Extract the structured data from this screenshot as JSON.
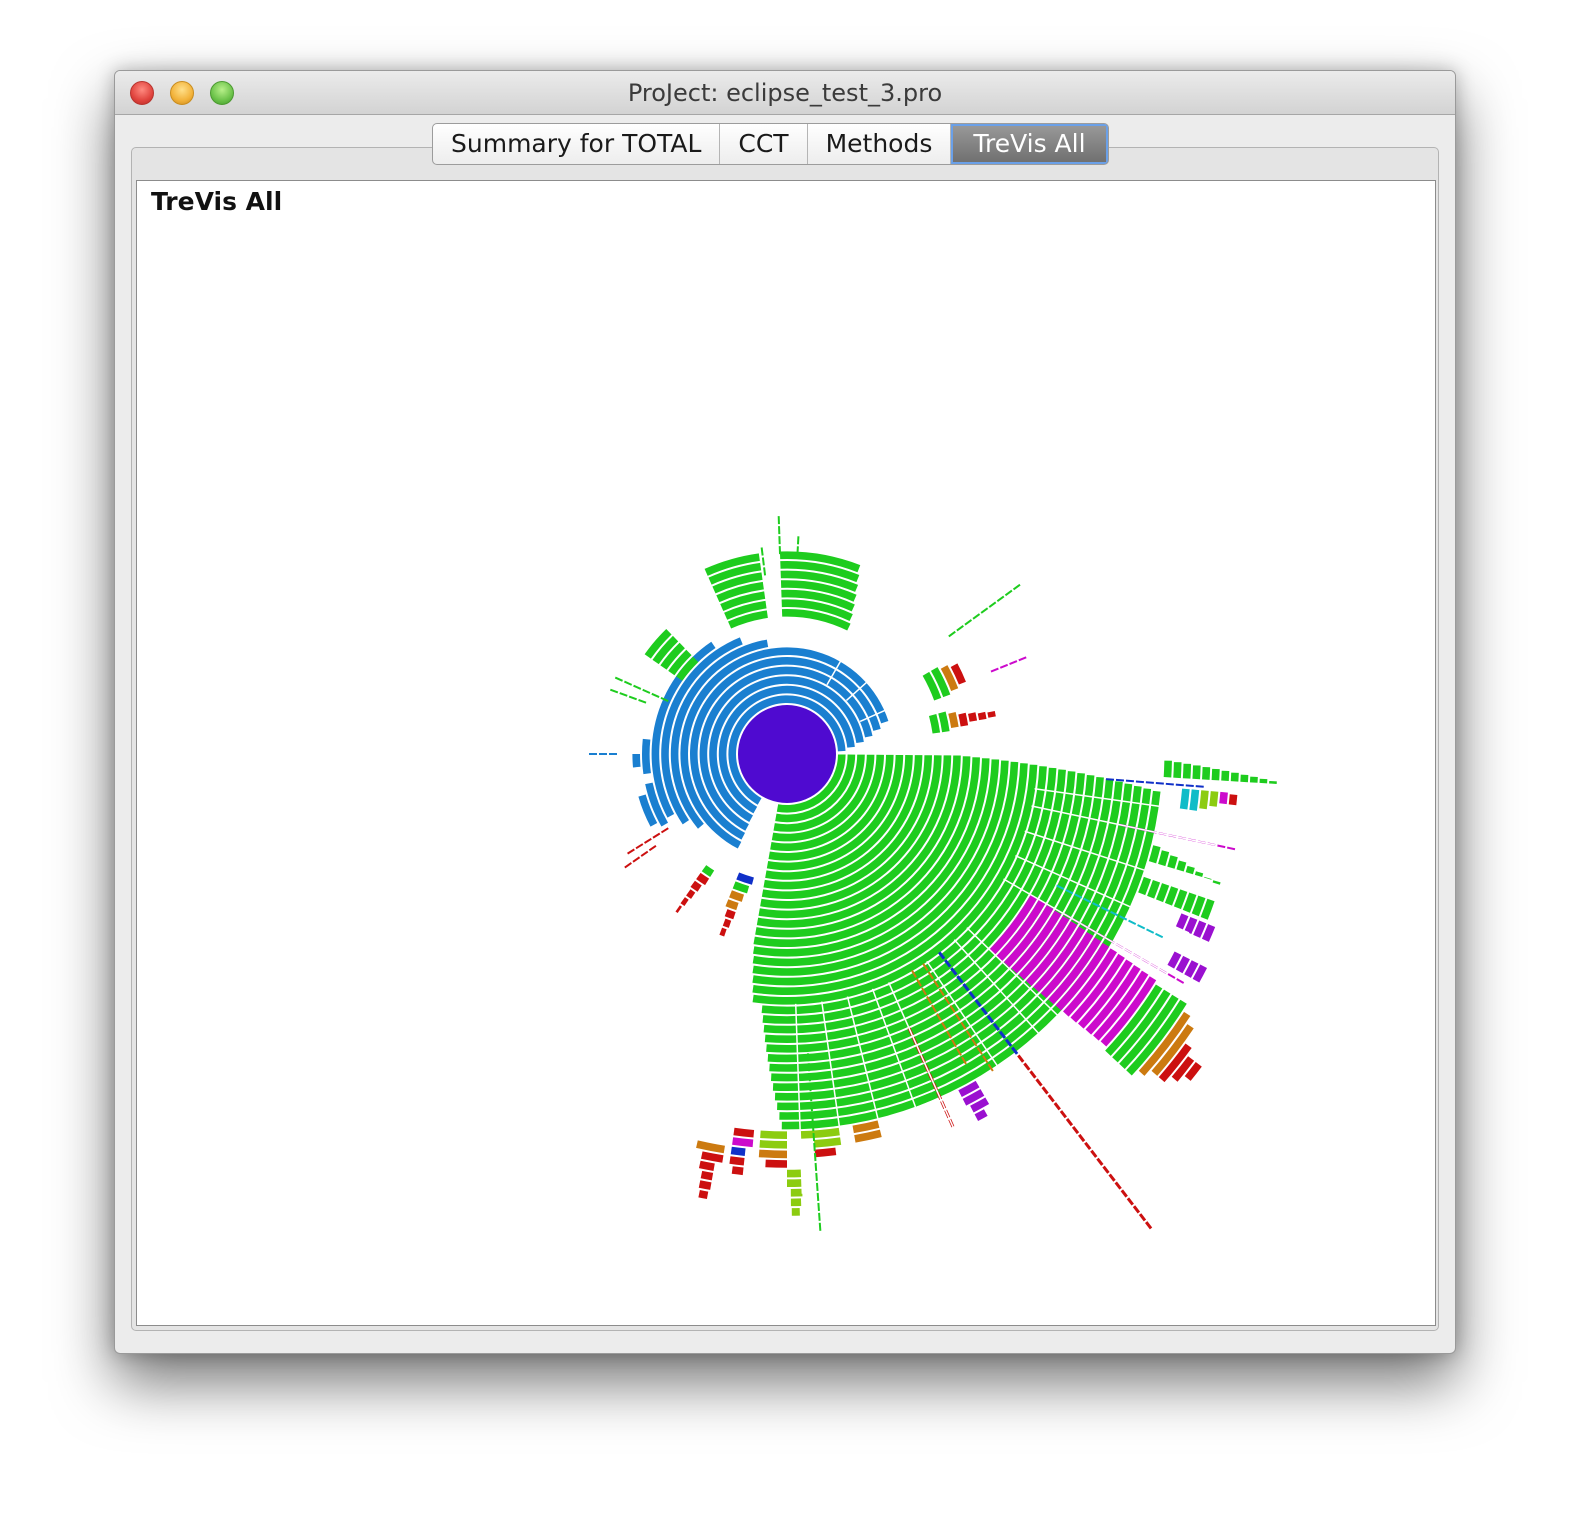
{
  "window": {
    "title": "ProJect: eclipse_test_3.pro"
  },
  "tabs": [
    {
      "label": "Summary for TOTAL",
      "active": false
    },
    {
      "label": "CCT",
      "active": false
    },
    {
      "label": "Methods",
      "active": false
    },
    {
      "label": "TreVis All",
      "active": true
    }
  ],
  "view": {
    "title": "TreVis All"
  },
  "colors": {
    "root": "#4f0ad0",
    "blue": "#1a7fd0",
    "green": "#1ecc1e",
    "magenta": "#cc0acc",
    "red": "#cc1010",
    "orange": "#cc7a10",
    "yellow_green": "#8ccc10",
    "cyan": "#10bcc8",
    "dark_blue": "#1030c8",
    "purple": "#9a10d0"
  }
}
